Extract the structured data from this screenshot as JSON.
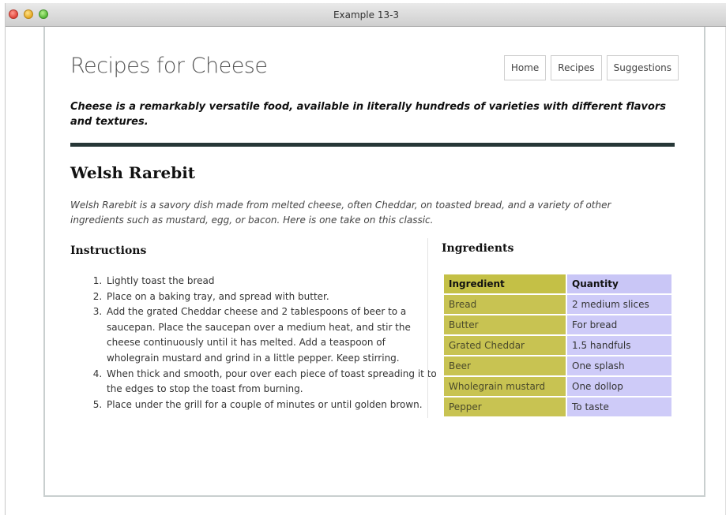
{
  "window": {
    "title": "Example 13-3"
  },
  "header": {
    "site_title": "Recipes for Cheese",
    "nav": [
      {
        "label": "Home"
      },
      {
        "label": "Recipes"
      },
      {
        "label": "Suggestions"
      }
    ],
    "tagline": "Cheese is a remarkably versatile food, available in literally hundreds of varieties with different flavors and textures."
  },
  "recipe": {
    "title": "Welsh Rarebit",
    "intro": "Welsh Rarebit is a savory dish made from melted cheese, often Cheddar, on toasted bread, and a variety of other ingredients such as mustard, egg, or bacon. Here is one take on this classic.",
    "instructions_heading": "Instructions",
    "steps": [
      "Lightly toast the bread",
      "Place on a baking tray, and spread with butter.",
      "Add the grated Cheddar cheese and 2 tablespoons of beer to a saucepan. Place the saucepan over a medium heat, and stir the cheese continuously until it has melted. Add a teaspoon of wholegrain mustard and grind in a little pepper. Keep stirring.",
      "When thick and smooth, pour over each piece of toast spreading it to the edges to stop the toast from burning.",
      "Place under the grill for a couple of minutes or until golden brown."
    ],
    "ingredients_heading": "Ingredients",
    "table": {
      "headers": [
        "Ingredient",
        "Quantity"
      ],
      "rows": [
        [
          "Bread",
          "2 medium slices"
        ],
        [
          "Butter",
          "For bread"
        ],
        [
          "Grated Cheddar",
          "1.5 handfuls"
        ],
        [
          "Beer",
          "One splash"
        ],
        [
          "Wholegrain mustard",
          "One dollop"
        ],
        [
          "Pepper",
          "To taste"
        ]
      ]
    }
  },
  "colors": {
    "header_rule": "#273737",
    "ingredient_column": "#c8c352",
    "quantity_column": "#cecbf8"
  }
}
